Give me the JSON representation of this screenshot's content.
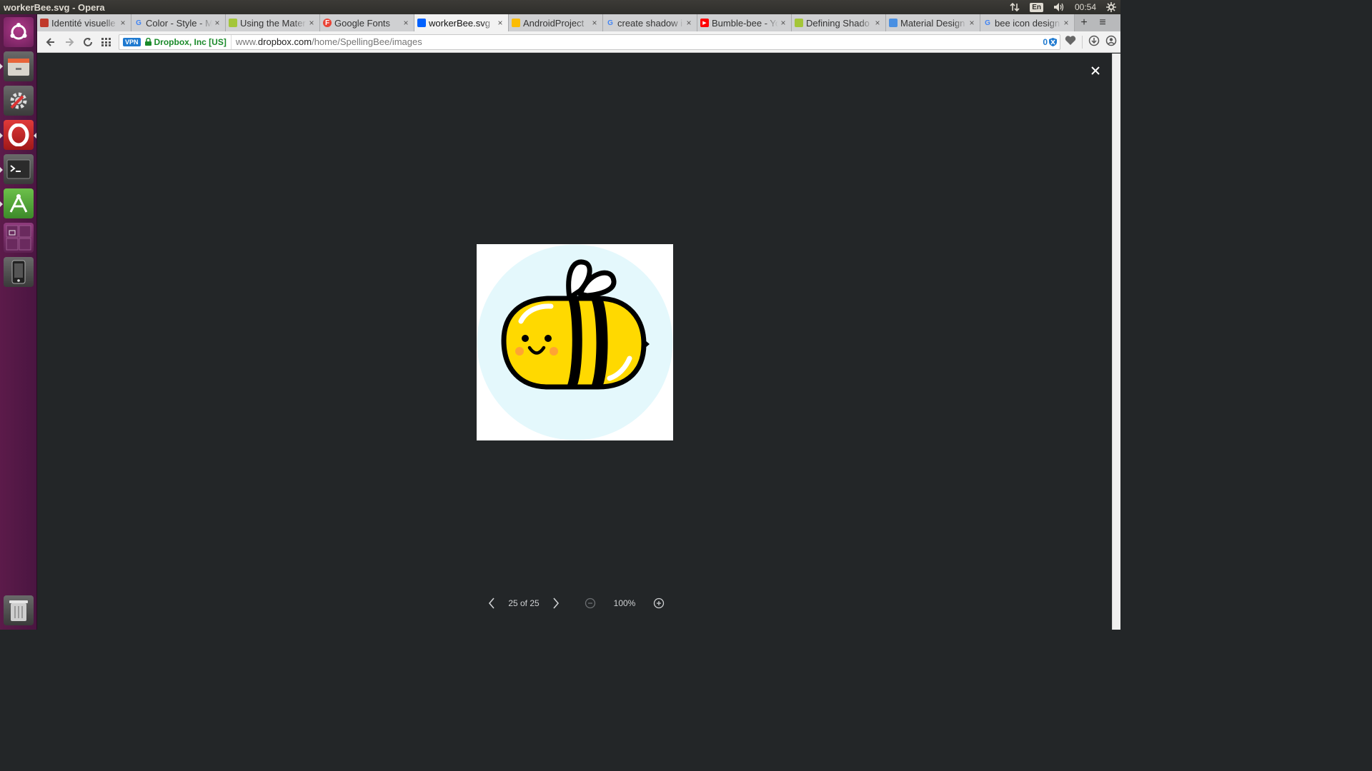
{
  "window": {
    "title": "workerBee.svg - Opera"
  },
  "system_tray": {
    "keyboard_layout": "En",
    "clock": "00:54"
  },
  "tabs": [
    {
      "label": "Identité visuelle",
      "favicon_color": "#c0392b",
      "favicon": "square"
    },
    {
      "label": "Color - Style - Ma",
      "favicon_color": "#4285f4",
      "favicon": "G"
    },
    {
      "label": "Using the Mater",
      "favicon_color": "#a4c639",
      "favicon": "android"
    },
    {
      "label": "Google Fonts",
      "favicon_color": "#ea4335",
      "favicon": "F"
    },
    {
      "label": "workerBee.svg",
      "favicon_color": "#0061fe",
      "favicon": "dropbox",
      "active": true
    },
    {
      "label": "AndroidProject",
      "favicon_color": "#fbbc04",
      "favicon": "drive"
    },
    {
      "label": "create shadow i",
      "favicon_color": "#4285f4",
      "favicon": "G"
    },
    {
      "label": "Bumble-bee - Yo",
      "favicon_color": "#ff0000",
      "favicon": "youtube"
    },
    {
      "label": "Defining Shado",
      "favicon_color": "#a4c639",
      "favicon": "android"
    },
    {
      "label": "Material Design",
      "favicon_color": "#4a90e2",
      "favicon": "windows"
    },
    {
      "label": "bee icon design",
      "favicon_color": "#4285f4",
      "favicon": "G"
    }
  ],
  "address_bar": {
    "vpn_label": "VPN",
    "site_identity": "Dropbox, Inc [US]",
    "url_prefix": "www.",
    "url_host": "dropbox.com",
    "url_path": "/home/SpellingBee/images",
    "adblock_count": "0"
  },
  "viewer": {
    "pagination": "25 of 25",
    "zoom": "100%",
    "image_name": "workerBee.svg"
  },
  "colors": {
    "viewer_bg": "#232628",
    "launcher_bg": "#4a1541",
    "bee_yellow": "#ffd900",
    "bee_circle": "#e4f8fc",
    "accent_blue": "#1f7ad0"
  }
}
